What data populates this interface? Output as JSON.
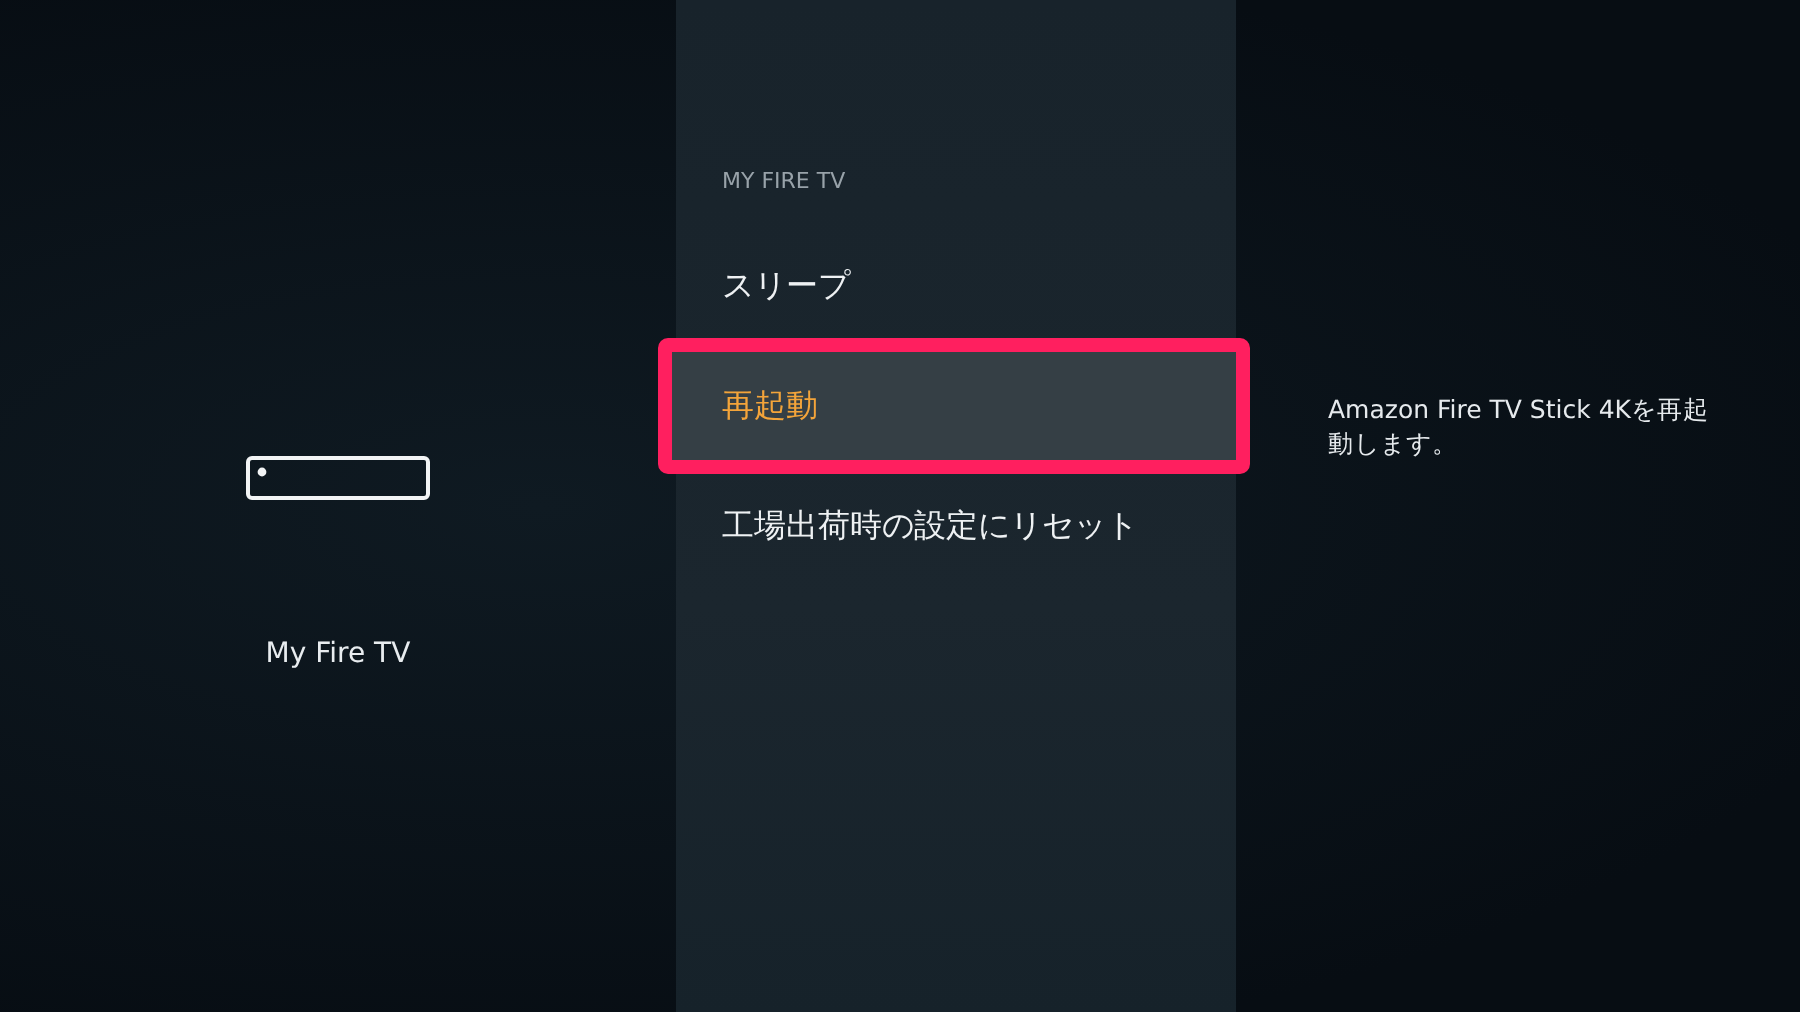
{
  "device_panel": {
    "label": "My Fire TV"
  },
  "menu": {
    "heading": "MY FIRE TV",
    "items": [
      {
        "label": "スリープ",
        "selected": false
      },
      {
        "label": "再起動",
        "selected": true
      },
      {
        "label": "工場出荷時の設定にリセット",
        "selected": false
      }
    ]
  },
  "description": "Amazon Fire TV Stick 4Kを再起動します。"
}
